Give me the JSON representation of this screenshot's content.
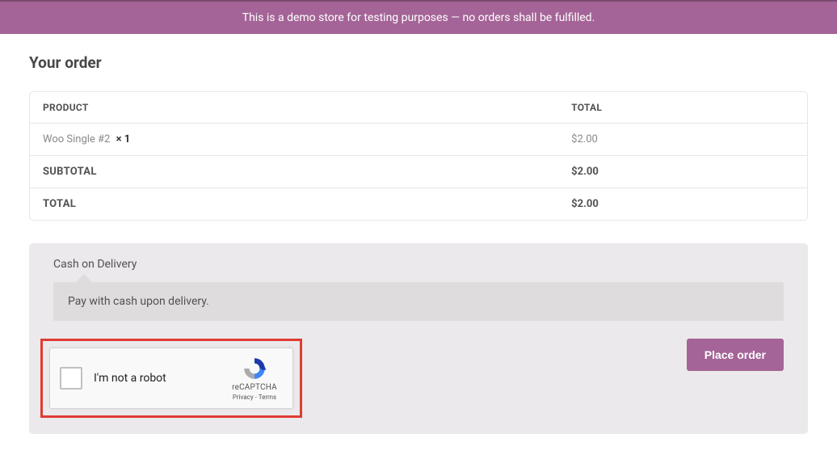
{
  "banner": {
    "text": "This is a demo store for testing purposes — no orders shall be fulfilled."
  },
  "order": {
    "title": "Your order",
    "headers": {
      "product": "PRODUCT",
      "total": "TOTAL"
    },
    "items": [
      {
        "name": "Woo Single #2",
        "qty": "× 1",
        "price": "$2.00"
      }
    ],
    "subtotal_label": "SUBTOTAL",
    "subtotal_value": "$2.00",
    "total_label": "TOTAL",
    "total_value": "$2.00"
  },
  "payment": {
    "method_label": "Cash on Delivery",
    "description": "Pay with cash upon delivery."
  },
  "recaptcha": {
    "label": "I'm not a robot",
    "brand": "reCAPTCHA",
    "privacy": "Privacy",
    "terms": "Terms",
    "sep": " - "
  },
  "actions": {
    "place_order": "Place order"
  }
}
